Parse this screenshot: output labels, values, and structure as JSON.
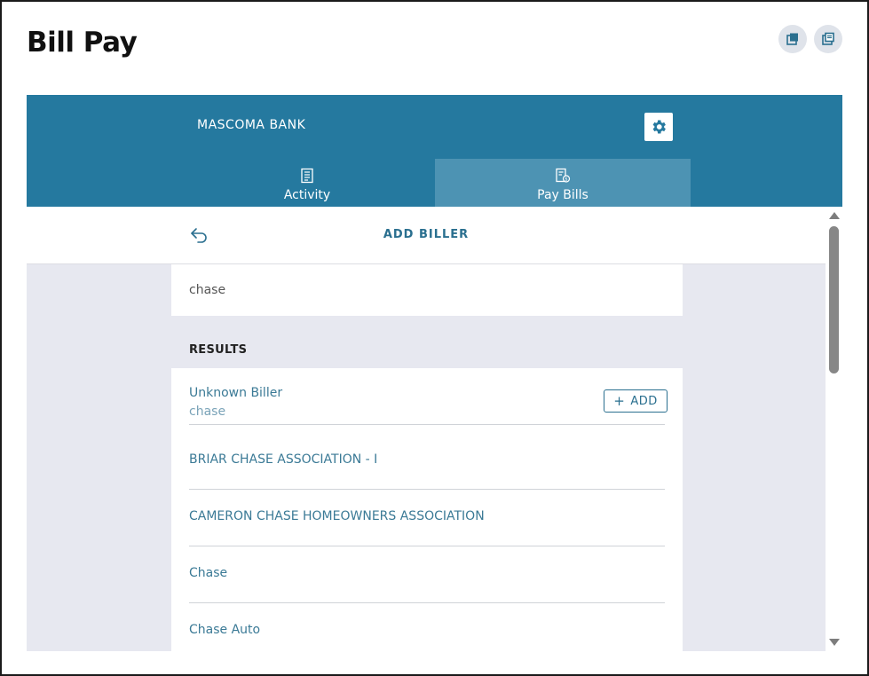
{
  "page": {
    "title": "Bill Pay"
  },
  "corner_buttons": [
    {
      "icon": "popout-icon"
    },
    {
      "icon": "copy-icon"
    }
  ],
  "bank": {
    "name": "MASCOMA BANK",
    "settings_icon": "gear-icon"
  },
  "tabs": [
    {
      "label": "Activity",
      "icon": "document-icon",
      "active": false
    },
    {
      "label": "Pay Bills",
      "icon": "bill-icon",
      "active": true
    }
  ],
  "add_biller": {
    "title": "ADD BILLER",
    "back_icon": "undo-arrow-icon",
    "search_value": "chase",
    "results_label": "RESULTS",
    "results": [
      {
        "name": "Unknown Biller",
        "subtitle": "chase",
        "action": "ADD"
      },
      {
        "name": "BRIAR CHASE ASSOCIATION - I"
      },
      {
        "name": "CAMERON CHASE HOMEOWNERS ASSOCIATION"
      },
      {
        "name": "Chase"
      },
      {
        "name": "Chase Auto"
      }
    ]
  },
  "colors": {
    "brand": "#25799f",
    "active_tab": "#4d93b3",
    "content_bg": "#e7e8f0",
    "link_text": "#3b7a96"
  }
}
